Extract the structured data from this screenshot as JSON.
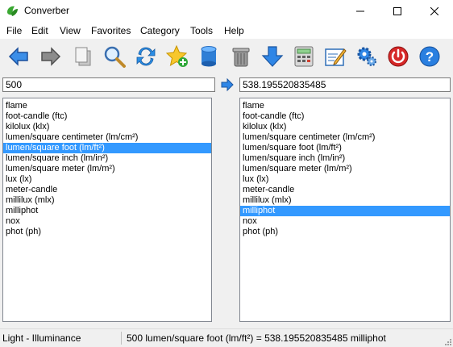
{
  "window": {
    "title": "Converber"
  },
  "menu": [
    "File",
    "Edit",
    "View",
    "Favorites",
    "Category",
    "Tools",
    "Help"
  ],
  "toolbar": {
    "buttons": [
      "back-icon",
      "forward-icon",
      "copy-icon",
      "search-icon",
      "refresh-icon",
      "add-favorite-icon",
      "database-icon",
      "trash-icon",
      "download-icon",
      "calculator-icon",
      "edit-icon",
      "settings-icon",
      "power-icon",
      "help-icon"
    ]
  },
  "input": {
    "value": "500"
  },
  "output": {
    "value": "538.195520835485"
  },
  "units": [
    "flame",
    "foot-candle (ftc)",
    "kilolux (klx)",
    "lumen/square centimeter (lm/cm²)",
    "lumen/square foot (lm/ft²)",
    "lumen/square inch (lm/in²)",
    "lumen/square meter (lm/m²)",
    "lux (lx)",
    "meter-candle",
    "millilux (mlx)",
    "milliphot",
    "nox",
    "phot (ph)"
  ],
  "from_selected": "lumen/square foot (lm/ft²)",
  "to_selected": "milliphot",
  "status": {
    "category": "Light - Illuminance",
    "result": "500 lumen/square foot (lm/ft²) = 538.195520835485 milliphot"
  },
  "colors": {
    "selection": "#3399ff",
    "accent_blue": "#1a73d9",
    "background": "#f0f0f0"
  }
}
